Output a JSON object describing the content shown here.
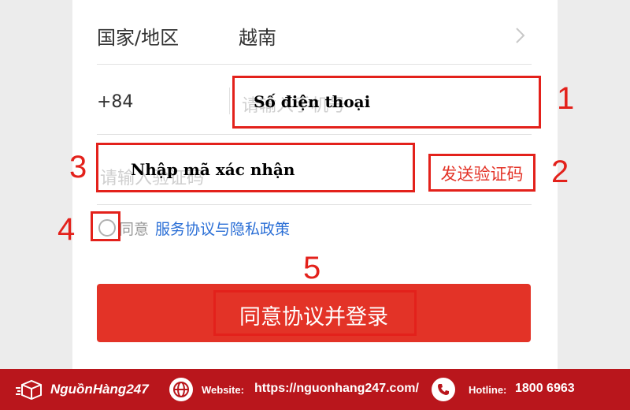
{
  "form": {
    "country_label": "国家/地区",
    "country_value": "越南",
    "phone_prefix": "+84",
    "phone_placeholder": "请输入手机号",
    "code_placeholder": "请输入验证码",
    "send_code_label": "发送验证码",
    "agree_text": "同意",
    "policy_link": "服务协议与隐私政策",
    "login_button": "同意协议并登录"
  },
  "annotations": {
    "phone_overlay": "Số điện thoại",
    "code_overlay": "Nhập mã xác nhận",
    "markers": [
      "1",
      "2",
      "3",
      "4",
      "5"
    ]
  },
  "footer": {
    "brand": "NguồnHàng247",
    "website_label": "Website:",
    "website_url": "https://nguonhang247.com/",
    "hotline_label": "Hotline:",
    "hotline_number": "1800 6963"
  },
  "colors": {
    "accent_red": "#e33327",
    "annotation_red": "#e3211b",
    "link_blue": "#2b6fd6",
    "footer_red": "#b9161c"
  },
  "icons": [
    "chevron-right-icon",
    "radio-icon",
    "globe-icon",
    "phone-icon",
    "brand-box-icon"
  ]
}
